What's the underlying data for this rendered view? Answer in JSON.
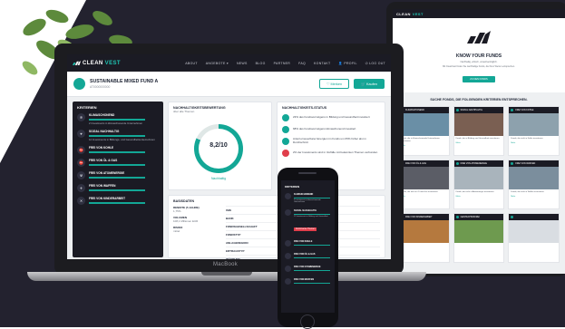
{
  "colors": {
    "accent": "#13a796",
    "dark": "#1b1b24",
    "background": "#23222f",
    "alert": "#e03e4b"
  },
  "laptop": {
    "brand": "MacBook",
    "nav": {
      "logo_prefix": "CLEAN",
      "logo_accent": "VEST",
      "items": [
        "ABOUT",
        "ANGEBOTE ▾",
        "NEWS",
        "BLOG",
        "PARTNER",
        "FAQ",
        "KONTAKT"
      ],
      "profile": "PROFIL",
      "logout": "LOG OUT"
    },
    "fund": {
      "title": "SUSTAINABLE MIXED FUND A",
      "subtitle": "AT0000000000",
      "watch_button": "Merken",
      "buy_button": "Kaufen"
    },
    "sidebar": {
      "title": "KRITERIEN",
      "items": [
        {
          "icon": "❄",
          "name": "KLIMASCHONEND",
          "desc": "2 Investments in klimaschonende Unternehmen"
        },
        {
          "icon": "♥",
          "name": "SOZIAL NACHHALTIG",
          "desc": "12 Investments in Bildungs- und Gesundheitsunternehmen"
        },
        {
          "icon": "⛔",
          "name": "FREI VON KOHLE",
          "desc": ""
        },
        {
          "icon": "⛔",
          "name": "FREI VON ÖL & GAS",
          "desc": ""
        },
        {
          "icon": "☢",
          "name": "FREI VON ATOMENERGIE",
          "desc": ""
        },
        {
          "icon": "✈",
          "name": "FREI VON WAFFEN",
          "desc": ""
        },
        {
          "icon": "✕",
          "name": "FREI VON KINDERARBEIT",
          "desc": ""
        }
      ]
    },
    "rating": {
      "title": "NACHHALTIGKEITSBEWERTUNG",
      "subtitle": "über alle Themen",
      "score": "8,2/10",
      "score_fraction": 0.82,
      "label": "Nachhaltig"
    },
    "status": {
      "title": "NACHHALTIGKEITS-STATUS",
      "items": [
        {
          "color": "#13a796",
          "text": "23% des Fondsvermögens in Bildung und Gesundheit investiert"
        },
        {
          "color": "#13a796",
          "text": "68% des Fondsvermögens klimaschonend investiert"
        },
        {
          "color": "#13a796",
          "text": "Anteil erneuerbarer Energien im Fonds um 65% höher als im Durchschnitt"
        },
        {
          "color": "#e03e4b",
          "text": "2% der Investments sind in Vorfälle mit bekannten Themen verbunden"
        }
      ]
    },
    "basics": {
      "title": "BASISDATEN",
      "performance_label": "RENDITE (5 JAHRE)",
      "performance_value": "1,75%",
      "volume_label": "VOLUMEN",
      "volume_value": "108,1 Millionen EUR",
      "risk_label": "RISIKO",
      "risk_value": "mittel",
      "rows": [
        {
          "label": "ISIN",
          "value": ""
        },
        {
          "label": "BANK",
          "value": ""
        },
        {
          "label": "FONDSGESELLSCHAFT",
          "value": ""
        },
        {
          "label": "FONDSTYP",
          "value": ""
        },
        {
          "label": "ANLAGEREGION",
          "value": ""
        },
        {
          "label": "ERTRAGSTYP",
          "value": ""
        },
        {
          "label": "WÄHRUNG",
          "value": ""
        },
        {
          "label": "AUSGABEAUFSCHLAG",
          "value": ""
        }
      ]
    }
  },
  "tablet": {
    "logo_prefix": "CLEAN",
    "logo_accent": "VEST",
    "hero_title": "KNOW YOUR FUNDS",
    "hero_subtitle": "Nachhaltig, ethisch, umweltverträglich.",
    "hero_desc": "Mit CleanVest finden Sie nachhaltige Fonds, die Ihren Werten entsprechen.",
    "hero_button": "ZU DEN FONDS",
    "question": "SUCHE FONDS, DIE FOLGENDEN KRITERIEN ENTSPRECHEN.",
    "cards": [
      {
        "title": "KLIMASCHONEND",
        "text": "Fonds, die in klimaschonende Unternehmen investieren.",
        "color": "#6a8fa6",
        "more": "Mehr"
      },
      {
        "title": "SOZIAL NACHHALTIG",
        "text": "Fonds, die in Bildung und Gesundheit investieren.",
        "color": "#7a5f52",
        "more": "Mehr"
      },
      {
        "title": "FREI VON KOHLE",
        "text": "Fonds, die nicht in Kohle investieren.",
        "color": "#8da1ad",
        "more": "Mehr"
      },
      {
        "title": "FREI VON ÖL & GAS",
        "text": "Fonds, die nicht in Öl und Gas investieren.",
        "color": "#5b5d66",
        "more": "Mehr"
      },
      {
        "title": "FREI VON ATOMENERGIE",
        "text": "Fonds, die nicht in Atomenergie investieren.",
        "color": "#a9b4bc",
        "more": "Mehr"
      },
      {
        "title": "FREI VON WAFFEN",
        "text": "Fonds, die nicht in Waffen investieren.",
        "color": "#7b8e9d",
        "more": "Mehr"
      },
      {
        "title": "FREI VON KINDERARBEIT",
        "text": "",
        "color": "#b5793e",
        "more": ""
      },
      {
        "title": "GENTECHNIKFREI",
        "text": "",
        "color": "#6e9a4f",
        "more": ""
      },
      {
        "title": "",
        "text": "",
        "color": "#d9dde2",
        "more": ""
      }
    ]
  },
  "phone": {
    "title": "KRITERIEN",
    "items": [
      {
        "name": "KLIMASCHONEND",
        "desc": "2 Investments in klimaschonende Unternehmen",
        "alert": ""
      },
      {
        "name": "SOZIAL NACHHALTIG",
        "desc": "12 Investments in Bildung und Gesundheit",
        "alert": "Kontroverse Themen"
      },
      {
        "name": "FREI VON KOHLE",
        "desc": "",
        "alert": ""
      },
      {
        "name": "FREI VON ÖL & GAS",
        "desc": "",
        "alert": ""
      },
      {
        "name": "FREI VON ATOMENERGIE",
        "desc": "",
        "alert": ""
      },
      {
        "name": "FREI VON WAFFEN",
        "desc": "",
        "alert": ""
      }
    ]
  }
}
